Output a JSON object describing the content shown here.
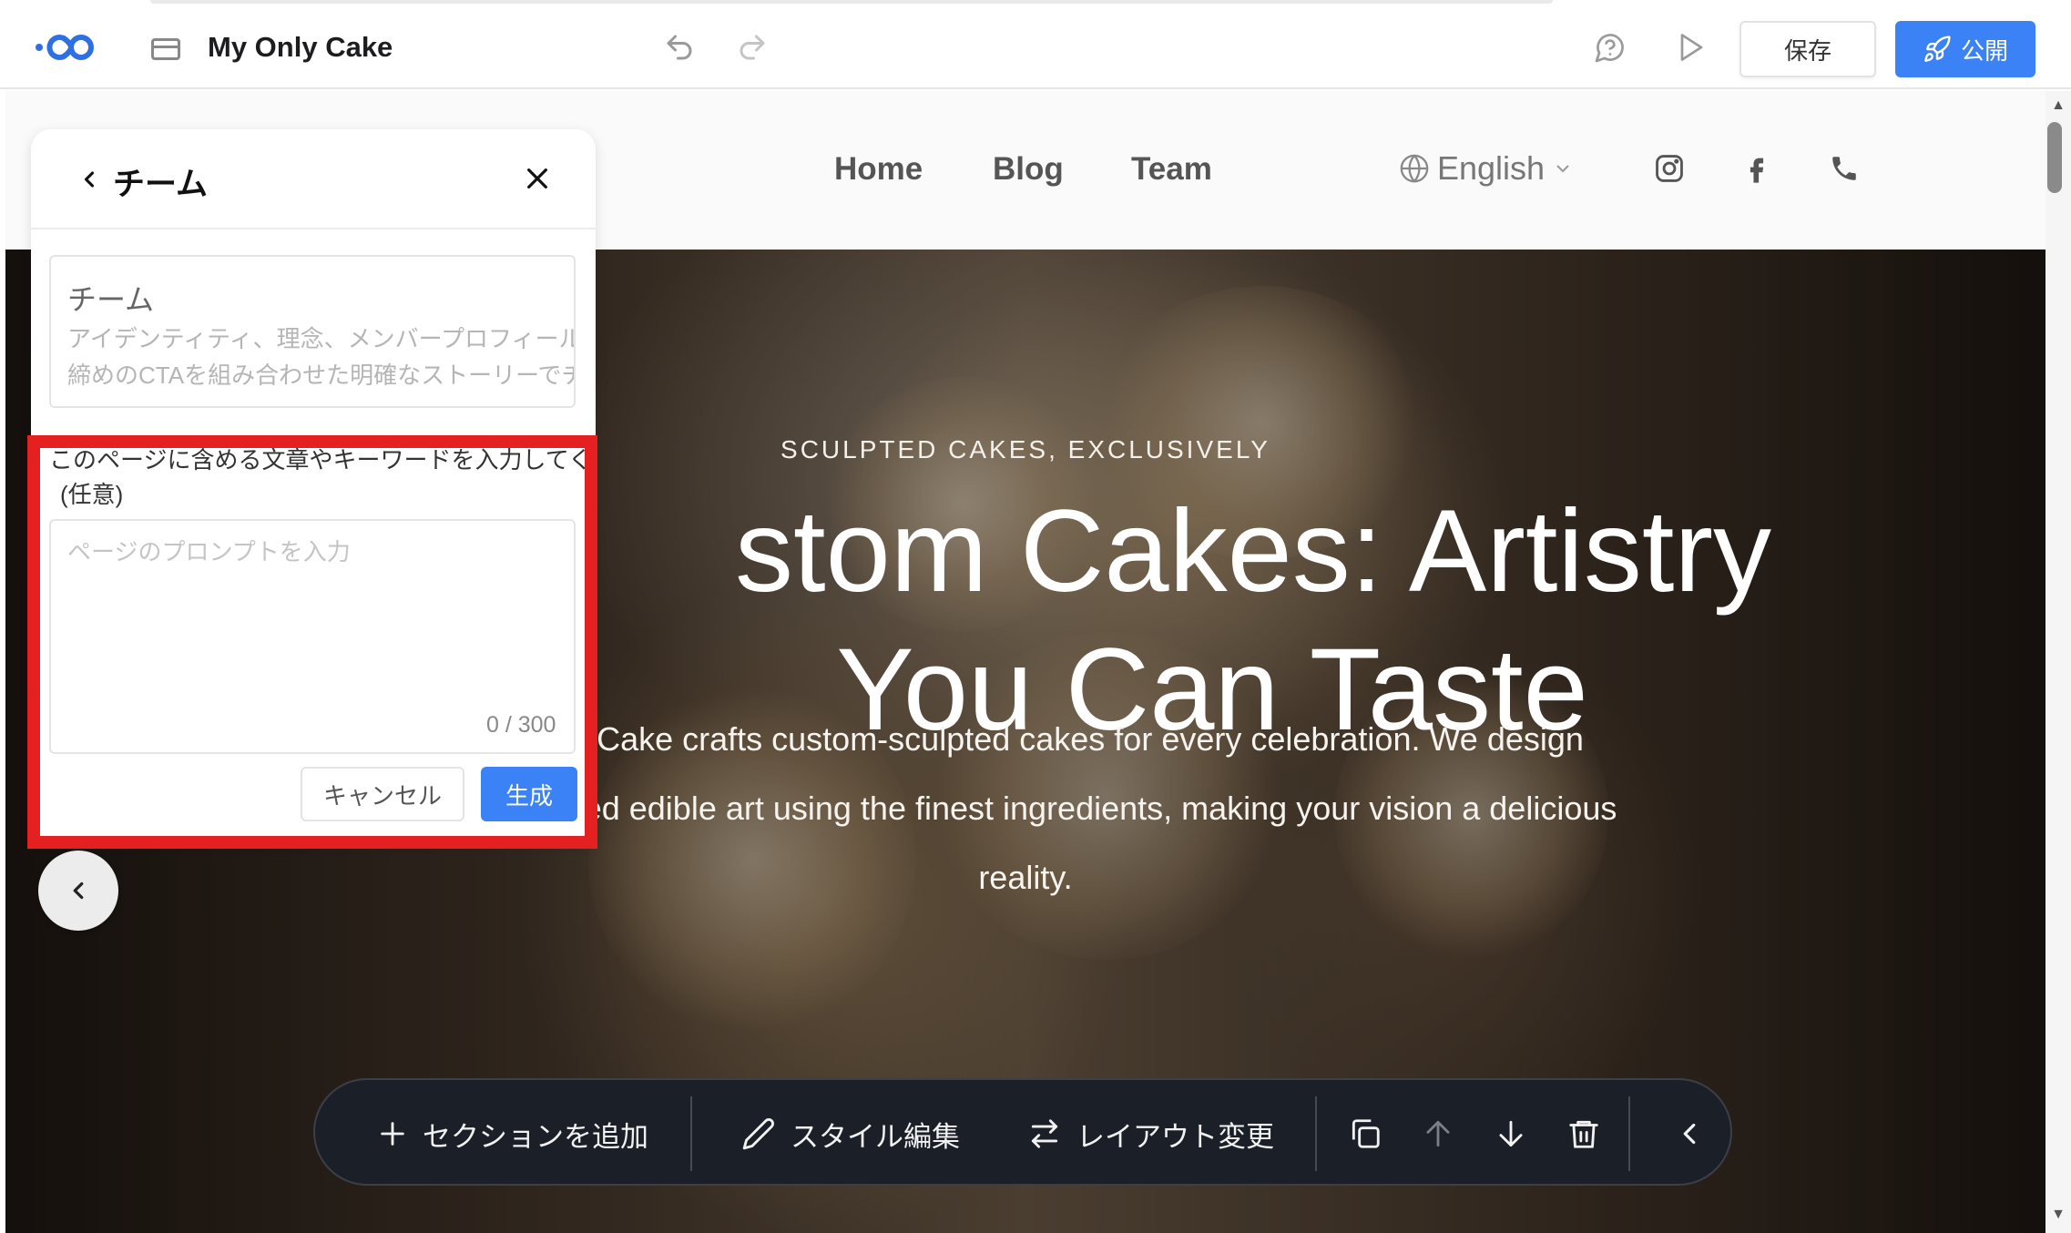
{
  "app": {
    "title": "My Only Cake",
    "save_label": "保存",
    "publish_label": "公開",
    "colors": {
      "accent": "#3b82f6",
      "highlight": "#e52020",
      "toolbar_bg": "#1b1f27"
    }
  },
  "site": {
    "nav": [
      {
        "label": "Home"
      },
      {
        "label": "Blog"
      },
      {
        "label": "Team"
      }
    ],
    "language": "English",
    "social_icons": [
      "instagram-icon",
      "facebook-icon",
      "phone-icon"
    ],
    "hero": {
      "eyebrow": "SCULPTED CAKES, EXCLUSIVELY",
      "title_line1": "stom Cakes: Artistry",
      "title_line2": "You Can Taste",
      "subtitle": "My Only Cake crafts custom-sculpted cakes for every celebration. We design personalized edible art using the finest ingredients, making your vision a delicious reality."
    }
  },
  "panel": {
    "title": "チーム",
    "template": {
      "name": "チーム",
      "description_line1": "アイデンティティ、理念、メンバープロフィール、",
      "description_line2": "締めのCTAを組み合わせた明確なストーリーでチー"
    },
    "prompt": {
      "label_line1": "このページに含める文章やキーワードを入力してく",
      "label_line2": "(任意)",
      "placeholder": "ページのプロンプトを入力",
      "value": "",
      "counter": "0 / 300"
    },
    "cancel_label": "キャンセル",
    "generate_label": "生成"
  },
  "toolbar": {
    "add_section": "セクションを追加",
    "edit_style": "スタイル編集",
    "change_layout": "レイアウト変更"
  }
}
